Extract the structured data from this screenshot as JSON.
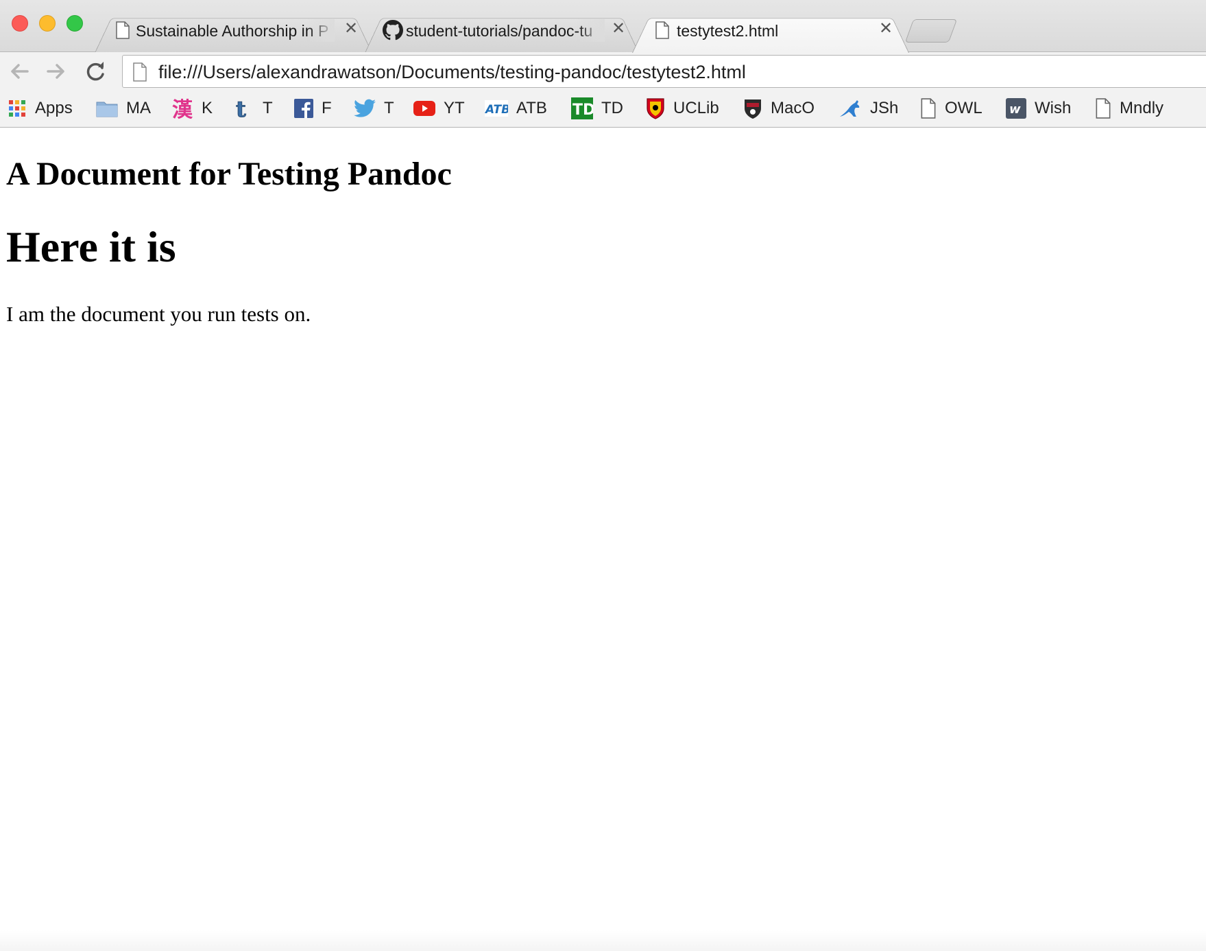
{
  "window": {
    "controls": [
      "close",
      "minimize",
      "maximize"
    ]
  },
  "tabs": [
    {
      "title": "Sustainable Authorship in P",
      "icon": "page-icon",
      "active": false
    },
    {
      "title": "student-tutorials/pandoc-tu",
      "icon": "github-icon",
      "active": false
    },
    {
      "title": "testytest2.html",
      "icon": "page-icon",
      "active": true
    }
  ],
  "tab_close_glyph": "✕",
  "toolbar": {
    "url": "file:///Users/alexandrawatson/Documents/testing-pandoc/testytest2.html"
  },
  "bookmarks": [
    {
      "label": "Apps",
      "icon": "apps-grid-icon"
    },
    {
      "label": "MA",
      "icon": "folder-icon"
    },
    {
      "label": "K",
      "icon": "kanji-icon"
    },
    {
      "label": "T",
      "icon": "tumblr-icon"
    },
    {
      "label": "F",
      "icon": "facebook-icon"
    },
    {
      "label": "T",
      "icon": "twitter-icon"
    },
    {
      "label": "YT",
      "icon": "youtube-icon"
    },
    {
      "label": "ATB",
      "icon": "atb-icon"
    },
    {
      "label": "TD",
      "icon": "td-bank-icon"
    },
    {
      "label": "UCLib",
      "icon": "ucalgary-crest-icon"
    },
    {
      "label": "MacO",
      "icon": "mac-shield-icon"
    },
    {
      "label": "JSh",
      "icon": "kangaroo-icon"
    },
    {
      "label": "OWL",
      "icon": "page-icon"
    },
    {
      "label": "Wish",
      "icon": "wish-icon"
    },
    {
      "label": "Mndly",
      "icon": "page-icon"
    }
  ],
  "document": {
    "title": "A Document for Testing Pandoc",
    "heading": "Here it is",
    "paragraph": "I am the document you run tests on."
  },
  "colors": {
    "close": "#fc5b57",
    "minimize": "#fdbc2e",
    "maximize": "#33c748",
    "facebook": "#3b5998",
    "twitter": "#1da1f2",
    "youtube": "#e62117",
    "td_green": "#1a8a2a"
  }
}
